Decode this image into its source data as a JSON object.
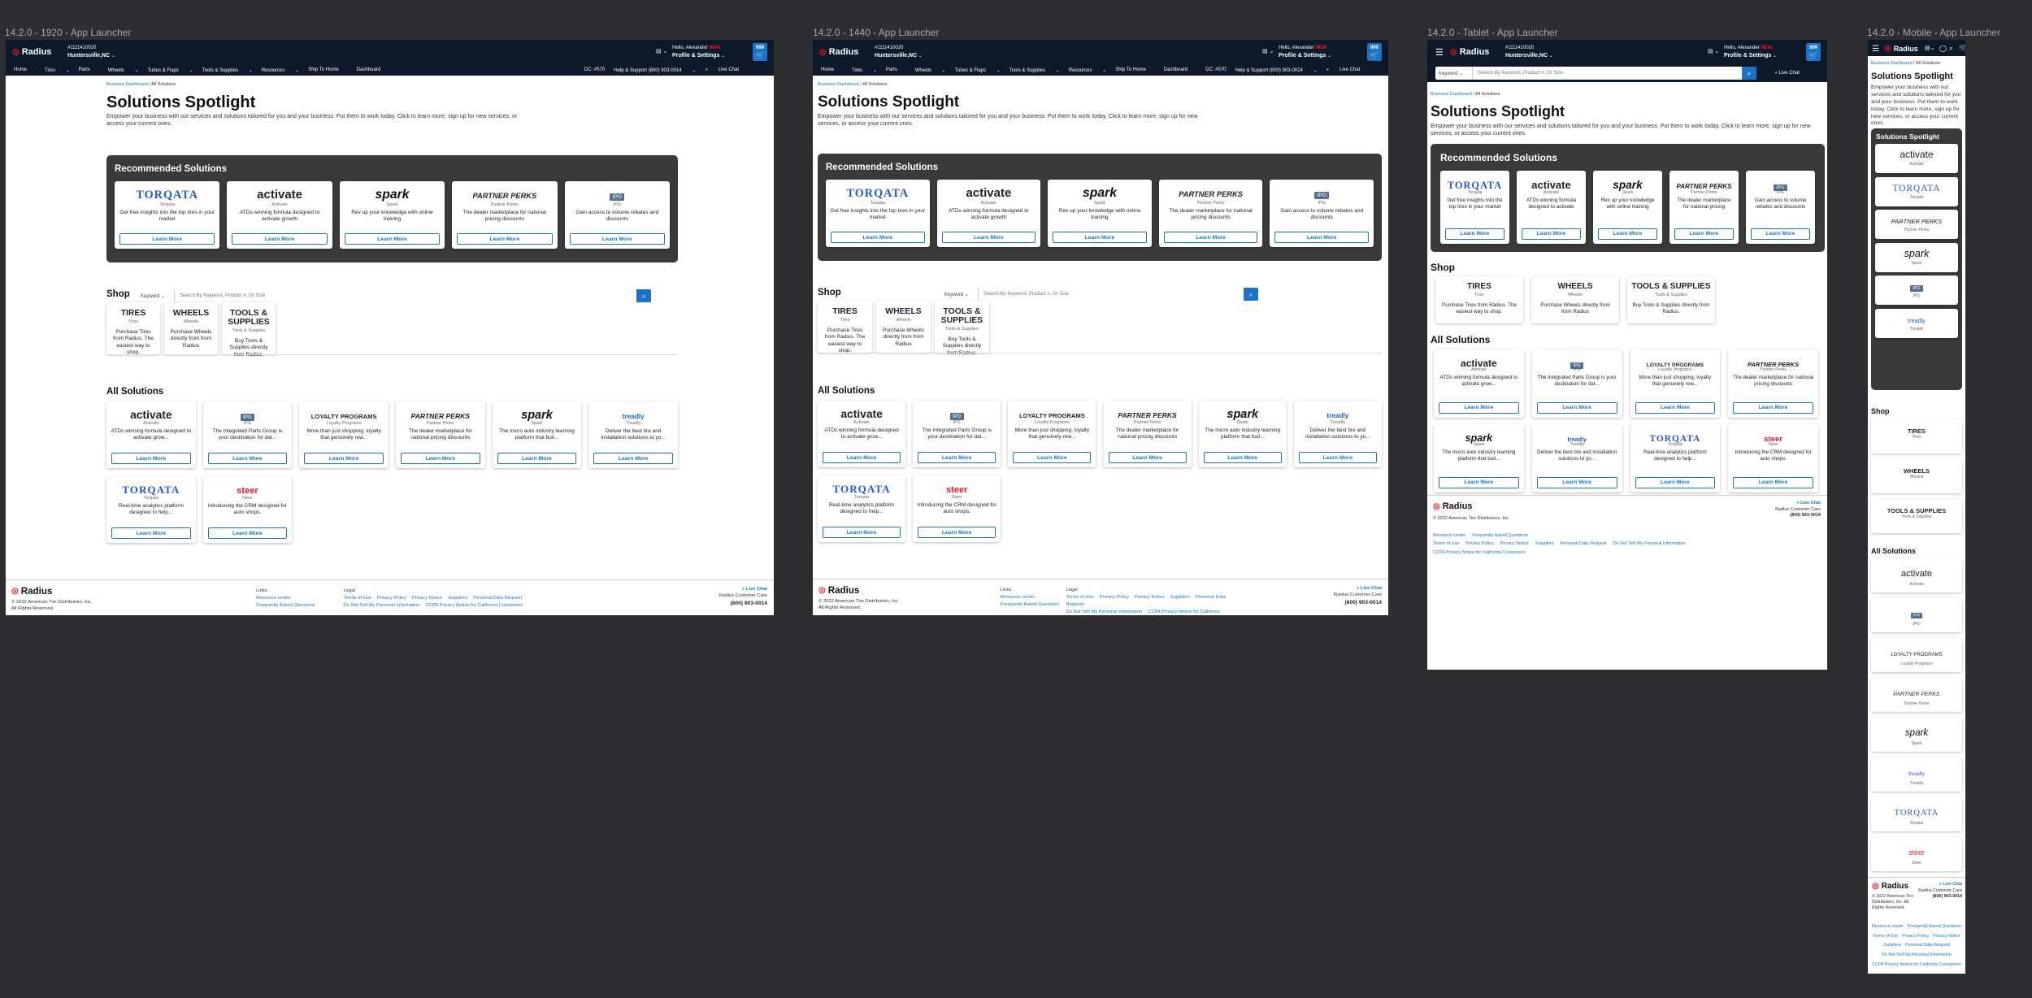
{
  "frame_labels": [
    "14.2.0 - 1920 - App Launcher",
    "14.2.0 - 1440 - App Launcher",
    "14.2.0 - Tablet - App Launcher",
    "14.2.0 - Mobile - App Launcher"
  ],
  "header": {
    "logo": "Radius",
    "account": "#1111410020",
    "location": "Huntersville,NC",
    "keyword_label": "Keyword",
    "search_placeholder": "Search By Keyword, Product #, Or Size",
    "greeting": "Hello, Alexander",
    "new_badge": "NEW",
    "profile_label": "Profile & Settings",
    "cart_count": "999",
    "dc": "DC: #570",
    "help": "Help & Support (800) 903-0014",
    "live_chat": "Live Chat"
  },
  "nav": [
    "Home",
    "Tires",
    "Parts",
    "Wheels",
    "Tubes & Flaps",
    "Tools & Supplies",
    "Resources",
    "Ship To Home",
    "Dashboard"
  ],
  "breadcrumb": {
    "parent": "Business Dashboard",
    "current": "All Solutions"
  },
  "page": {
    "title": "Solutions Spotlight",
    "intro": "Empower your business with our services and solutions tailored for you and your business. Put them to work today. Click to learn more, sign up for new services, or access your current ones.",
    "recommended_title": "Recommended Solutions",
    "shop_title": "Shop",
    "all_title": "All Solutions",
    "learn_more": "Learn More"
  },
  "recommended": [
    {
      "logo": "TORQATA",
      "name": "Torqata",
      "desc": "Get free insights into the top tires in your market",
      "icon": "torqata-logo"
    },
    {
      "logo": "activate",
      "name": "Activate",
      "desc": "ATDs winning formula designed to activate growth",
      "icon": "activate-logo"
    },
    {
      "logo": "spark",
      "name": "Spark",
      "desc": "Rev up your knowledge with online training",
      "icon": "spark-logo"
    },
    {
      "logo": "PARTNER PERKS",
      "name": "Partner Perks",
      "desc": "The dealer marketplace for national pricing discounts",
      "icon": "partner-perks-logo"
    },
    {
      "logo": "IPG",
      "name": "IPG",
      "desc": "Gain access to volume rebates and discounts",
      "icon": "ipg-logo"
    }
  ],
  "shop": [
    {
      "title": "TIRES",
      "name": "Tires",
      "desc": "Purchase Tires from Radius. The easiest way to shop."
    },
    {
      "title": "WHEELS",
      "name": "Wheels",
      "desc": "Purchase Wheels directly from from Radius"
    },
    {
      "title": "TOOLS & SUPPLIES",
      "name": "Tools & Supplies",
      "desc": "Buy Tools & Supplies directly from Radius."
    }
  ],
  "all_solutions": [
    {
      "logo": "activate",
      "name": "Activate",
      "desc": "ATDs winning formula designed to activate grow...",
      "icon": "activate-logo"
    },
    {
      "logo": "IPG",
      "name": "IPG",
      "desc": "The Integrated Parts Group is your destination for dat...",
      "icon": "ipg-logo"
    },
    {
      "logo": "LOYALTY PROGRAMS",
      "name": "Loyalty Programs",
      "desc": "More than just shopping, loyalty that genuinely rew...",
      "icon": "loyalty-logo"
    },
    {
      "logo": "PARTNER PERKS",
      "name": "Partner Perks",
      "desc": "The dealer marketplace for national pricing discounts",
      "icon": "partner-perks-logo"
    },
    {
      "logo": "spark",
      "name": "Spark",
      "desc": "The micro auto industry learning platform that buil...",
      "icon": "spark-logo"
    },
    {
      "logo": "treadly",
      "name": "Treadly",
      "desc": "Deliver the best tire and installation solutions to yo...",
      "icon": "treadly-logo"
    },
    {
      "logo": "TORQATA",
      "name": "Torqata",
      "desc": "Real-time analytics platform designed to help...",
      "icon": "torqata-logo"
    },
    {
      "logo": "steer",
      "name": "Steer",
      "desc": "Introducing the CRM designed for auto shops.",
      "icon": "steer-logo"
    }
  ],
  "footer": {
    "copyright": "© 2022 American Tire Distributors, Inc.",
    "rights": "All Rights Reserved.",
    "links_title": "Links",
    "links": [
      "Resource center",
      "Frequently Asked Questions"
    ],
    "legal_title": "Legal",
    "legal": [
      "Terms of Use",
      "Privacy Policy",
      "Privacy Notice",
      "Suppliers",
      "Personal Data Request",
      "Do Not Sell My Personal Information",
      "CCPA Privacy Notice for California Consumers"
    ],
    "live_chat": "Live Chat",
    "care": "Radius Customer Care",
    "phone": "(800) 903-0014"
  },
  "mobile": {
    "spotlight_title": "Solutions Spotlight",
    "spotlight": [
      {
        "logo": "activate",
        "name": "Activate"
      },
      {
        "logo": "TORQATA",
        "name": "Torqata"
      },
      {
        "logo": "PARTNER PERKS",
        "name": "Partner Perks"
      },
      {
        "logo": "spark",
        "name": "Spark"
      },
      {
        "logo": "IPG",
        "name": "IPG"
      },
      {
        "logo": "treadly",
        "name": "Treadly"
      }
    ],
    "shop": [
      {
        "title": "TIRES",
        "name": "Tires"
      },
      {
        "title": "WHEELS",
        "name": "Wheels"
      },
      {
        "title": "TOOLS & SUPPLIES",
        "name": "Tools & Supplies"
      }
    ],
    "all": [
      {
        "logo": "activate",
        "name": "Activate"
      },
      {
        "logo": "IPG",
        "name": "IPG"
      },
      {
        "logo": "LOYALTY PROGRAMS",
        "name": "Loyalty Programs"
      },
      {
        "logo": "PARTNER PERKS",
        "name": "Partner Perks"
      },
      {
        "logo": "spark",
        "name": "Spark"
      },
      {
        "logo": "treadly",
        "name": "Treadly"
      },
      {
        "logo": "TORQATA",
        "name": "Torqata"
      },
      {
        "logo": "steer",
        "name": "Steer"
      }
    ]
  },
  "colors": {
    "background": "#2c2e31",
    "header": "#0d1829",
    "accent": "#1a73c7",
    "brand_red": "#e31b23",
    "panel": "#3a3a3a",
    "live_chat": "#3bc45a"
  }
}
